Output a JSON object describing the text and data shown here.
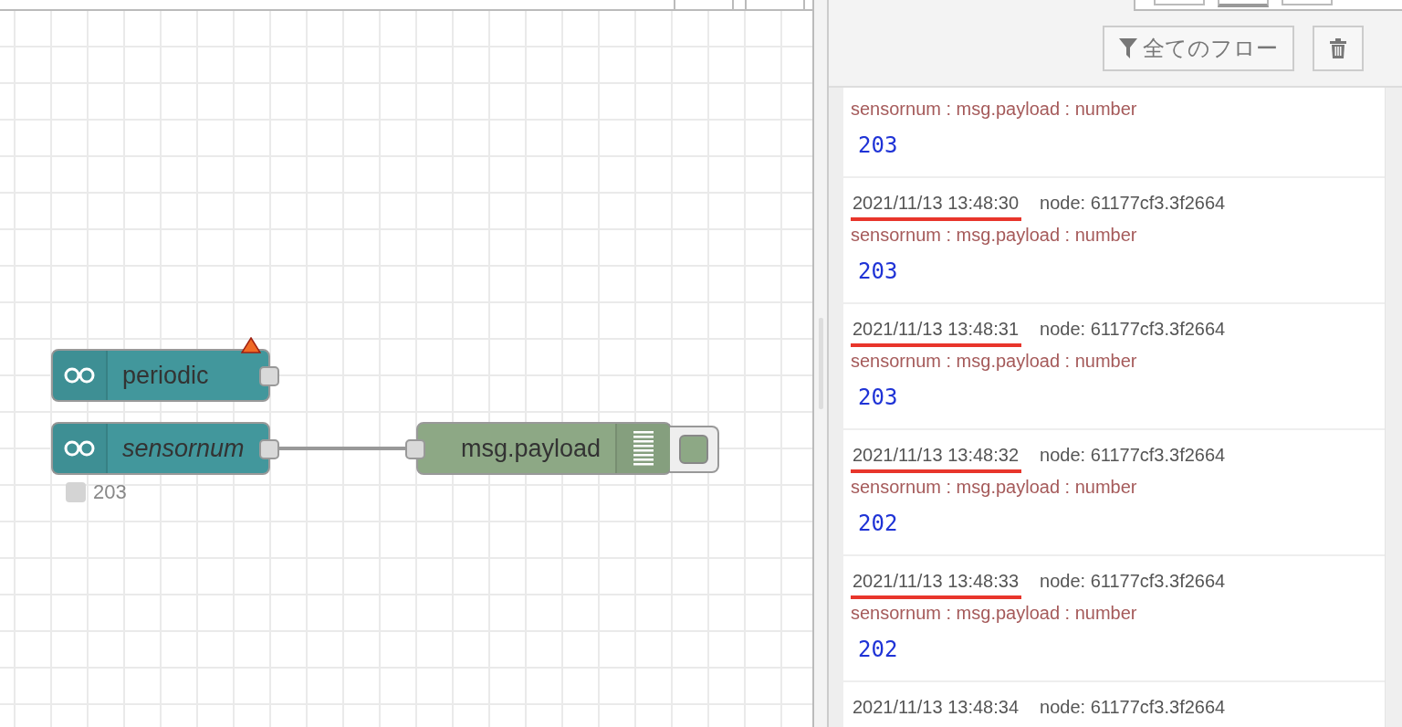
{
  "workspace_tabs": [
    {
      "selected": false
    },
    {
      "selected": false
    }
  ],
  "nodes": [
    {
      "kind": "inject",
      "label": "periodic",
      "italic": false,
      "warning": true
    },
    {
      "kind": "inject",
      "label": "sensornum",
      "italic": true,
      "warning": false,
      "status": "203"
    },
    {
      "kind": "debug",
      "label": "msg.payload",
      "italic": false,
      "warning": false,
      "active": true
    }
  ],
  "sidebar_tabs": [
    {
      "selected": false
    },
    {
      "selected": true
    },
    {
      "selected": false
    }
  ],
  "filter_button": {
    "label": "全てのフロー"
  },
  "messages": [
    {
      "topic": "sensornum : msg.payload : number",
      "value": "203"
    },
    {
      "time": "2021/11/13 13:48:30",
      "node": "node: 61177cf3.3f2664",
      "topic": "sensornum : msg.payload : number",
      "value": "203",
      "underlined": true
    },
    {
      "time": "2021/11/13 13:48:31",
      "node": "node: 61177cf3.3f2664",
      "topic": "sensornum : msg.payload : number",
      "value": "203",
      "underlined": true
    },
    {
      "time": "2021/11/13 13:48:32",
      "node": "node: 61177cf3.3f2664",
      "topic": "sensornum : msg.payload : number",
      "value": "202",
      "underlined": true
    },
    {
      "time": "2021/11/13 13:48:33",
      "node": "node: 61177cf3.3f2664",
      "topic": "sensornum : msg.payload : number",
      "value": "202",
      "underlined": true
    },
    {
      "time": "2021/11/13 13:48:34",
      "node": "node: 61177cf3.3f2664"
    }
  ]
}
